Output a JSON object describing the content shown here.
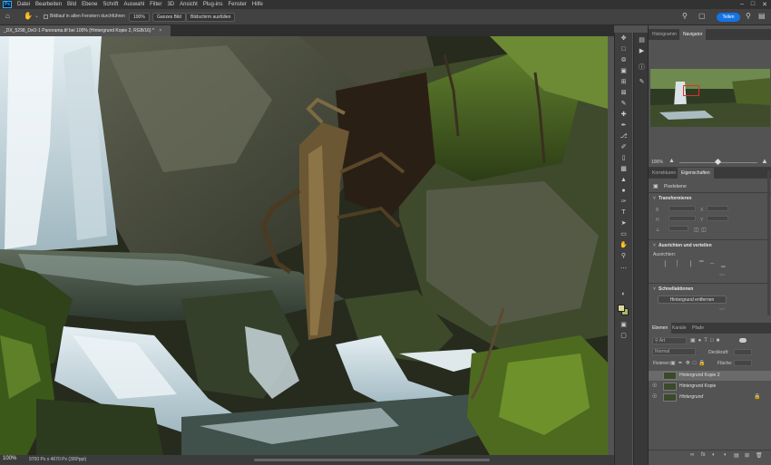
{
  "menubar": {
    "logo": "Ps",
    "items": [
      "Datei",
      "Bearbeiten",
      "Bild",
      "Ebene",
      "Schrift",
      "Auswahl",
      "Filter",
      "3D",
      "Ansicht",
      "Plug-ins",
      "Fenster",
      "Hilfe"
    ]
  },
  "options": {
    "scroll_all_label": "Bildlauf in allen Fenstern durchführen",
    "zoom_100": "100%",
    "fit_screen": "Ganzes Bild",
    "fill_screen": "Bildschirm ausfüllen",
    "share": "Teilen"
  },
  "document": {
    "tab_title": "_DX_5298_DxO-1 Panorama.tif bei 100% (Hintergrund Kopie 2, RGB/16) *",
    "zoom": "100%",
    "info": "9700 Px x 4670 Px (300 ppi)"
  },
  "panels": {
    "top_tabs": [
      "Histogramm",
      "Navigator"
    ],
    "navigator_zoom": "100%",
    "mid_tabs": [
      "Korrekturen",
      "Eigenschaften"
    ],
    "pixel_layer": "Pixelebene",
    "transform_title": "Transformieren",
    "align_title": "Ausrichten und verteilen",
    "align_to": "Ausrichten:",
    "quick_title": "Schnellaktionen",
    "remove_bg": "Hintergrund entfernen",
    "layer_tabs": [
      "Ebenen",
      "Kanäle",
      "Pfade"
    ],
    "kind_filter": "Art",
    "blend_mode": "Normal",
    "opacity_label": "Deckkraft:",
    "lock_label": "Fixieren:",
    "fill_label": "Fläche:",
    "layers": [
      {
        "name": "Hintergrund Kopie 2",
        "selected": true,
        "visible": false
      },
      {
        "name": "Hintergrund Kopie",
        "selected": false,
        "visible": true
      },
      {
        "name": "Hintergrund",
        "selected": false,
        "visible": true
      }
    ]
  },
  "colors": {
    "foreground": "#d8d99b",
    "background": "#a9b85e",
    "accent": "#1473e6"
  }
}
